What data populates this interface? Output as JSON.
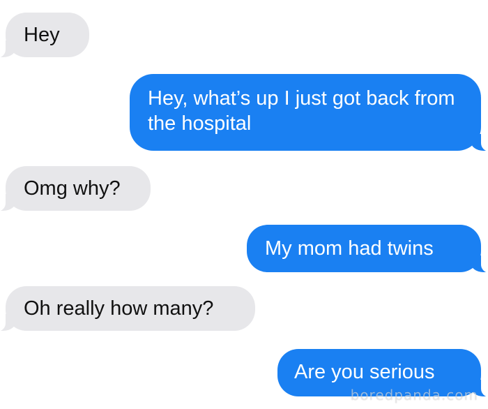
{
  "conversation": {
    "messages": [
      {
        "direction": "incoming",
        "text": "Hey"
      },
      {
        "direction": "outgoing",
        "text": "Hey, what’s up I just got back from the hospital"
      },
      {
        "direction": "incoming",
        "text": "Omg why?"
      },
      {
        "direction": "outgoing",
        "text": "My mom had twins"
      },
      {
        "direction": "incoming",
        "text": "Oh really how many?"
      },
      {
        "direction": "outgoing",
        "text": "Are you serious"
      }
    ]
  },
  "watermark": {
    "text": "boredpanda.com"
  },
  "colors": {
    "incoming_bubble": "#e7e7ea",
    "outgoing_bubble": "#1a80f2",
    "background": "#ffffff"
  }
}
